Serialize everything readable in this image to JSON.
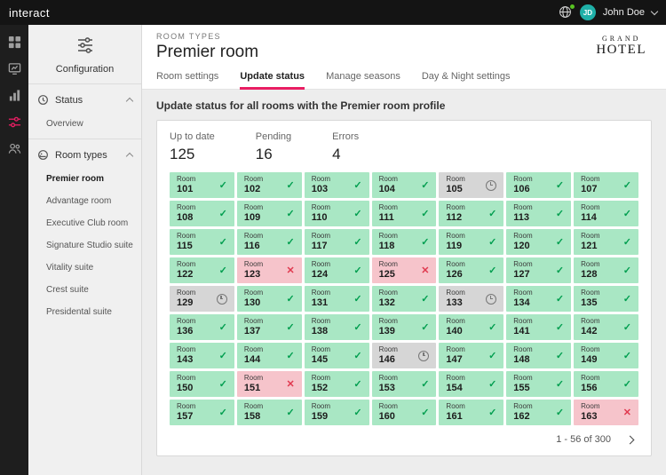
{
  "topbar": {
    "brand": "interact",
    "user": {
      "initials": "JD",
      "name": "John Doe"
    }
  },
  "nav_rail": {
    "items": [
      {
        "icon": "dashboard-icon",
        "active": false
      },
      {
        "icon": "reports-icon",
        "active": false
      },
      {
        "icon": "analytics-icon",
        "active": false
      },
      {
        "icon": "configuration-icon",
        "active": true
      },
      {
        "icon": "users-icon",
        "active": false
      }
    ]
  },
  "sidebar": {
    "title": "Configuration",
    "sections": [
      {
        "label": "Status",
        "icon": "status-section-icon",
        "expanded": true,
        "items": [
          {
            "label": "Overview",
            "active": false
          }
        ]
      },
      {
        "label": "Room types",
        "icon": "room-types-section-icon",
        "expanded": true,
        "items": [
          {
            "label": "Premier room",
            "active": true
          },
          {
            "label": "Advantage room",
            "active": false
          },
          {
            "label": "Executive Club room",
            "active": false
          },
          {
            "label": "Signature Studio suite",
            "active": false
          },
          {
            "label": "Vitality suite",
            "active": false
          },
          {
            "label": "Crest suite",
            "active": false
          },
          {
            "label": "Presidental suite",
            "active": false
          }
        ]
      }
    ]
  },
  "header": {
    "breadcrumb": "ROOM TYPES",
    "title": "Premier room",
    "logo_line1": "GRAND",
    "logo_line2": "HOTEL"
  },
  "tabs": [
    {
      "label": "Room settings",
      "active": false
    },
    {
      "label": "Update status",
      "active": true
    },
    {
      "label": "Manage seasons",
      "active": false
    },
    {
      "label": "Day & Night settings",
      "active": false
    }
  ],
  "section_title": "Update status for all rooms with the Premier room profile",
  "stats": [
    {
      "label": "Up to date",
      "value": "125"
    },
    {
      "label": "Pending",
      "value": "16"
    },
    {
      "label": "Errors",
      "value": "4"
    }
  ],
  "rooms": {
    "tile_label": "Room",
    "tiles": [
      {
        "number": "101",
        "status": "ok"
      },
      {
        "number": "102",
        "status": "ok"
      },
      {
        "number": "103",
        "status": "ok"
      },
      {
        "number": "104",
        "status": "ok"
      },
      {
        "number": "105",
        "status": "pending"
      },
      {
        "number": "106",
        "status": "ok"
      },
      {
        "number": "107",
        "status": "ok"
      },
      {
        "number": "108",
        "status": "ok"
      },
      {
        "number": "109",
        "status": "ok"
      },
      {
        "number": "110",
        "status": "ok"
      },
      {
        "number": "111",
        "status": "ok"
      },
      {
        "number": "112",
        "status": "ok"
      },
      {
        "number": "113",
        "status": "ok"
      },
      {
        "number": "114",
        "status": "ok"
      },
      {
        "number": "115",
        "status": "ok"
      },
      {
        "number": "116",
        "status": "ok"
      },
      {
        "number": "117",
        "status": "ok"
      },
      {
        "number": "118",
        "status": "ok"
      },
      {
        "number": "119",
        "status": "ok"
      },
      {
        "number": "120",
        "status": "ok"
      },
      {
        "number": "121",
        "status": "ok"
      },
      {
        "number": "122",
        "status": "ok"
      },
      {
        "number": "123",
        "status": "error"
      },
      {
        "number": "124",
        "status": "ok"
      },
      {
        "number": "125",
        "status": "error"
      },
      {
        "number": "126",
        "status": "ok"
      },
      {
        "number": "127",
        "status": "ok"
      },
      {
        "number": "128",
        "status": "ok"
      },
      {
        "number": "129",
        "status": "pending"
      },
      {
        "number": "130",
        "status": "ok"
      },
      {
        "number": "131",
        "status": "ok"
      },
      {
        "number": "132",
        "status": "ok"
      },
      {
        "number": "133",
        "status": "pending"
      },
      {
        "number": "134",
        "status": "ok"
      },
      {
        "number": "135",
        "status": "ok"
      },
      {
        "number": "136",
        "status": "ok"
      },
      {
        "number": "137",
        "status": "ok"
      },
      {
        "number": "138",
        "status": "ok"
      },
      {
        "number": "139",
        "status": "ok"
      },
      {
        "number": "140",
        "status": "ok"
      },
      {
        "number": "141",
        "status": "ok"
      },
      {
        "number": "142",
        "status": "ok"
      },
      {
        "number": "143",
        "status": "ok"
      },
      {
        "number": "144",
        "status": "ok"
      },
      {
        "number": "145",
        "status": "ok"
      },
      {
        "number": "146",
        "status": "pending"
      },
      {
        "number": "147",
        "status": "ok"
      },
      {
        "number": "148",
        "status": "ok"
      },
      {
        "number": "149",
        "status": "ok"
      },
      {
        "number": "150",
        "status": "ok"
      },
      {
        "number": "151",
        "status": "error"
      },
      {
        "number": "152",
        "status": "ok"
      },
      {
        "number": "153",
        "status": "ok"
      },
      {
        "number": "154",
        "status": "ok"
      },
      {
        "number": "155",
        "status": "ok"
      },
      {
        "number": "156",
        "status": "ok"
      },
      {
        "number": "157",
        "status": "ok"
      },
      {
        "number": "158",
        "status": "ok"
      },
      {
        "number": "159",
        "status": "ok"
      },
      {
        "number": "160",
        "status": "ok"
      },
      {
        "number": "161",
        "status": "ok"
      },
      {
        "number": "162",
        "status": "ok"
      },
      {
        "number": "163",
        "status": "error"
      }
    ]
  },
  "pagination": {
    "range": "1 - 56 of 300"
  },
  "colors": {
    "accent_pink": "#e91e63",
    "ok_bg": "#a9e7c4",
    "ok_icon": "#009e4f",
    "pending_bg": "#d6d6d6",
    "pending_icon": "#777777",
    "error_bg": "#f6c4cb",
    "error_icon": "#e0394f",
    "avatar_teal": "#1fb0a8",
    "presence_green": "#58c322"
  }
}
